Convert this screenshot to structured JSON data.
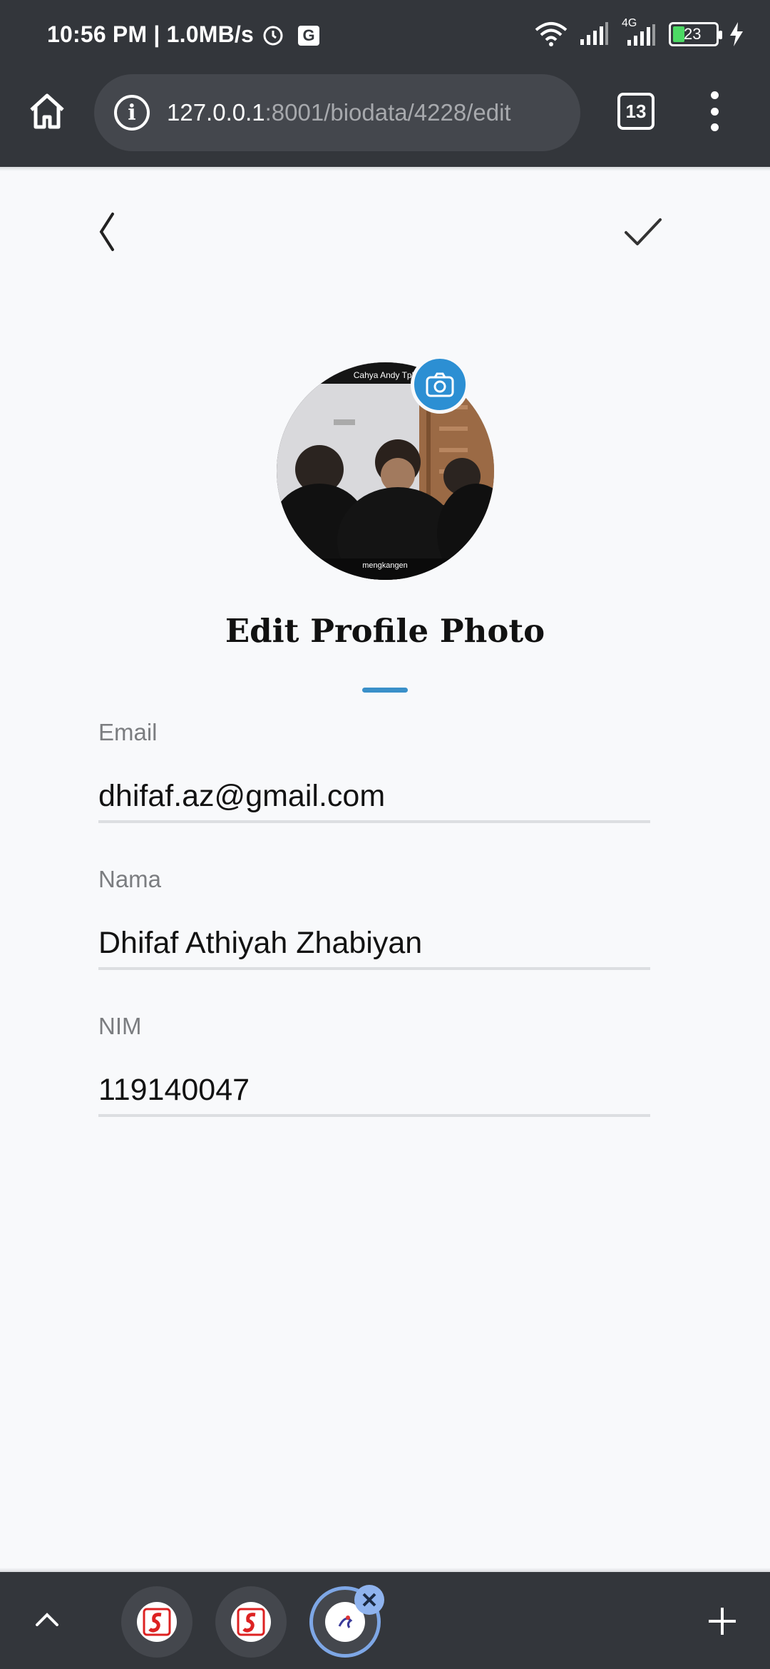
{
  "status_bar": {
    "time_speed": "10:56 PM | 1.0MB/s",
    "network_type": "4G",
    "battery_level": "23"
  },
  "browser": {
    "url_host": "127.0.0.1",
    "url_path": ":8001/biodata/4228/edit",
    "tab_count": "13"
  },
  "profile": {
    "photo_title": "Edit Profile Photo",
    "photo_caption_top": "Cahya Andy Tpb",
    "photo_caption_bottom": "mengkangen"
  },
  "fields": [
    {
      "label": "Email",
      "value": "dhifaf.az@gmail.com"
    },
    {
      "label": "Nama",
      "value": "Dhifaf Athiyah Zhabiyan"
    },
    {
      "label": "NIM",
      "value": "119140047"
    }
  ],
  "colors": {
    "chrome_dark": "#33363b",
    "accent_blue": "#2c8fd3",
    "underline_blue": "#3a90c9"
  }
}
